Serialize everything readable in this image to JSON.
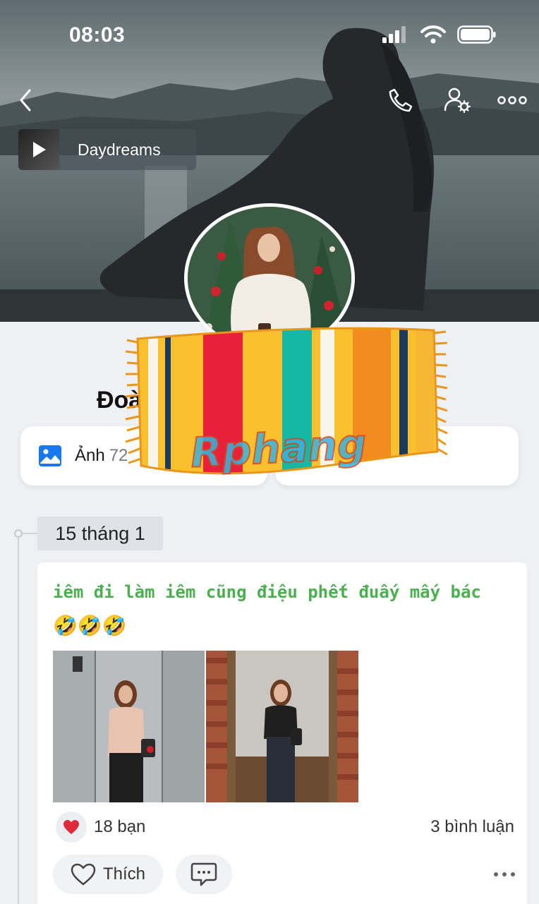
{
  "status_bar": {
    "time": "08:03"
  },
  "cover": {
    "music_title": "Daydreams"
  },
  "profile": {
    "name_left": "Đoà",
    "name_right": "ễ"
  },
  "quick_links": [
    {
      "label": "Ảnh",
      "count": "72",
      "icon": "photo-icon"
    },
    {
      "label": "",
      "count": "",
      "icon": ""
    }
  ],
  "sticker": {
    "text": "Rphang"
  },
  "timeline": {
    "date": "15 tháng 1",
    "post": {
      "text": "iêm đi làm iêm cũng điệu phết đuấy mấy bác",
      "emoji": "🤣🤣🤣",
      "reaction_count": "18 bạn",
      "comment_count": "3 bình luận",
      "like_label": "Thích"
    }
  },
  "colors": {
    "post_text": "#4caf50",
    "heart": "#e0293a",
    "photo_icon": "#1877f2"
  }
}
